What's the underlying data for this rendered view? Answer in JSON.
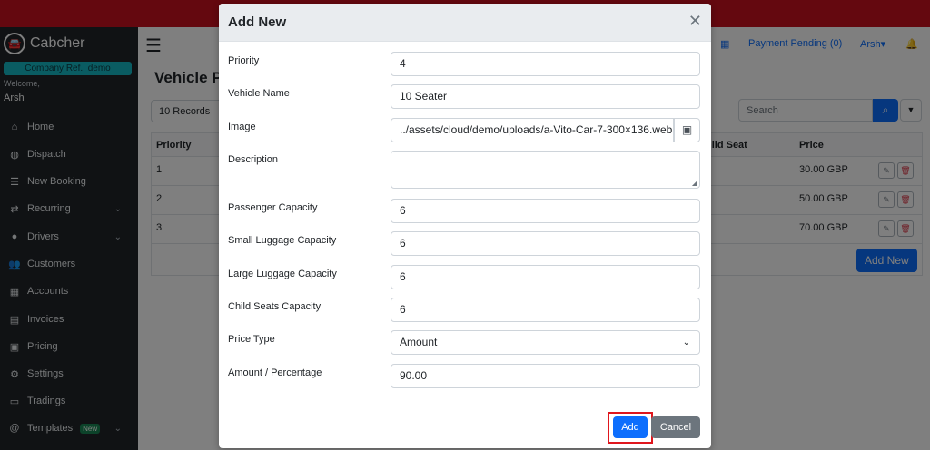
{
  "app": {
    "name": "Cabcher",
    "company_ref": "Company Ref.: demo",
    "welcome": "Welcome,",
    "user": "Arsh"
  },
  "sidebar": {
    "items": [
      {
        "label": "Home",
        "icon": "home-icon"
      },
      {
        "label": "Dispatch",
        "icon": "globe-icon"
      },
      {
        "label": "New Booking",
        "icon": "list-icon"
      },
      {
        "label": "Recurring",
        "icon": "repeat-icon"
      },
      {
        "label": "Drivers",
        "icon": "user-icon"
      },
      {
        "label": "Customers",
        "icon": "users-icon"
      },
      {
        "label": "Accounts",
        "icon": "building-icon"
      },
      {
        "label": "Invoices",
        "icon": "file-icon"
      },
      {
        "label": "Pricing",
        "icon": "money-icon"
      },
      {
        "label": "Settings",
        "icon": "gear-icon"
      },
      {
        "label": "Tradings",
        "icon": "archive-icon"
      },
      {
        "label": "Templates",
        "icon": "at-icon",
        "badge": "New"
      }
    ]
  },
  "header": {
    "payment_pending": "Payment Pending (0)",
    "user_menu": "Arsh"
  },
  "page": {
    "title": "Vehicle P",
    "records": "10 Records",
    "search_placeholder": "Search",
    "add_new": "Add New",
    "table": {
      "columns": [
        "Priority",
        "hild Seat",
        "Price"
      ],
      "rows": [
        {
          "priority": "1",
          "price": "30.00 GBP"
        },
        {
          "priority": "2",
          "price": "50.00 GBP"
        },
        {
          "priority": "3",
          "price": "70.00 GBP"
        }
      ]
    }
  },
  "modal": {
    "title": "Add New",
    "fields": {
      "priority": {
        "label": "Priority",
        "value": "4"
      },
      "vehicle_name": {
        "label": "Vehicle Name",
        "value": "10 Seater"
      },
      "image": {
        "label": "Image",
        "value": "../assets/cloud/demo/uploads/a-Vito-Car-7-300×136.web"
      },
      "description": {
        "label": "Description",
        "value": ""
      },
      "passenger_capacity": {
        "label": "Passenger Capacity",
        "value": "6"
      },
      "small_luggage": {
        "label": "Small Luggage Capacity",
        "value": "6"
      },
      "large_luggage": {
        "label": "Large Luggage Capacity",
        "value": "6"
      },
      "child_seats": {
        "label": "Child Seats Capacity",
        "value": "6"
      },
      "price_type": {
        "label": "Price Type",
        "value": "Amount"
      },
      "amount": {
        "label": "Amount / Percentage",
        "value": "90.00"
      }
    },
    "add_label": "Add",
    "cancel_label": "Cancel"
  },
  "colors": {
    "topbar": "#c8101e",
    "sidebar": "#212529",
    "primary": "#0d6efd",
    "highlight": "#e0161d"
  }
}
